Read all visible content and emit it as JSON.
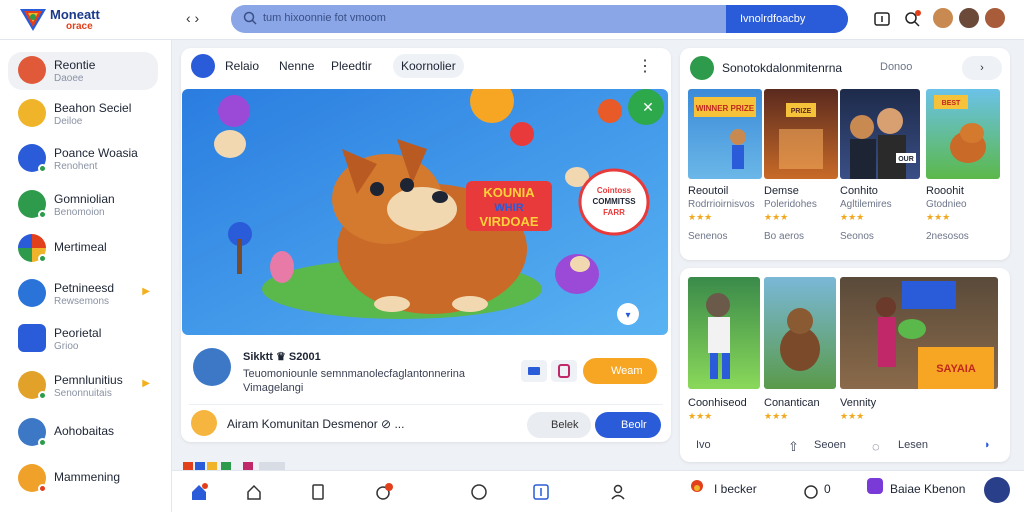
{
  "app": {
    "brand_line1": "Moneatt",
    "brand_line2": "orace"
  },
  "header": {
    "back_label": "‹ ›",
    "search_placeholder": "tum hixoonnie fot vmoom",
    "search_button": "Ivnolrdfoacby",
    "notification_count": "1"
  },
  "sidebar": {
    "items": [
      {
        "title": "Reontie",
        "subtitle": "Daoee",
        "color": "#e05a3a"
      },
      {
        "title": "Beahon Seciel",
        "subtitle": "Deiloe",
        "color": "#f0b42a"
      },
      {
        "title": "Poance Woasia",
        "subtitle": "Renohent",
        "color": "#2a5bd8"
      },
      {
        "title": "Gomniolian",
        "subtitle": "Benomoion",
        "color": "#2d9b4b"
      },
      {
        "title": "Mertimeal",
        "subtitle": "",
        "color": "#e2401c"
      },
      {
        "title": "Petnineesd",
        "subtitle": "Rewsemons",
        "color": "#2a73d8"
      },
      {
        "title": "Peorietal",
        "subtitle": "Grioo",
        "color": "#2a5bd8"
      },
      {
        "title": "Pemnlunitius",
        "subtitle": "Senonnuitais",
        "color": "#e2a22a"
      },
      {
        "title": "Aohobaitas",
        "subtitle": "",
        "color": "#3c78c6"
      },
      {
        "title": "Mammening",
        "subtitle": "",
        "color": "#f0a12a"
      }
    ]
  },
  "main": {
    "tabs": [
      "Relaio",
      "Nenne",
      "Pleedtir",
      "Koornolier"
    ],
    "hero": {
      "banner_line1": "KOUNIA",
      "banner_line2": "WHIR",
      "banner_line3": "VIRDOAE",
      "bubble_line1": "Cointoss",
      "bubble_line2": "COMMITSS",
      "bubble_line3": "FARR"
    },
    "post": {
      "title": "Sikktt ♛ S2001",
      "desc_line1": "Teuomoniounle semnmanolecfaglantonnerina",
      "desc_line2": "Vimagelangi",
      "join_label": "Weam"
    },
    "community": {
      "text": "Airam Komunitan Desmenor ⊘ ...",
      "btn_grey": "Belek",
      "btn_blue": "Beolr"
    }
  },
  "right_panel": {
    "title": "Sonotokdalonmitenrna",
    "subtitle": "Donoo",
    "button": "›",
    "cards": [
      {
        "title": "Reoutoil",
        "sub": "Rodrrioirnisvos",
        "stars": "★★★",
        "count": "Senenos"
      },
      {
        "title": "Demse",
        "sub": "Poleridohes",
        "stars": "★★★",
        "count": "Bo aeros"
      },
      {
        "title": "Conhito",
        "sub": "Agltilemires",
        "stars": "★★★",
        "count": "Seonos"
      },
      {
        "title": "Rooohit",
        "sub": "Gtodnieo",
        "stars": "★★★",
        "count": "2nesosos"
      }
    ],
    "card_badges": [
      "WINNER PRIZE",
      "PRIZE",
      "OUR",
      "BEST"
    ]
  },
  "right_panel2": {
    "videos": [
      {
        "title": "Coonhiseod",
        "stars": "★★★"
      },
      {
        "title": "Conantican",
        "stars": "★★★"
      },
      {
        "title": "Vennity",
        "stars": "★★★"
      }
    ],
    "overlay_text": "SAYAIA",
    "footer": {
      "left": "Ivo",
      "mid": "Seoen",
      "right": "Lesen"
    }
  },
  "bottom_nav": {
    "left_text": "I becker",
    "mid_count": "0",
    "right_text": "Baiae Kbenon",
    "badge_count": "1"
  },
  "colors": {
    "accent": "#2a5bd8",
    "orange": "#f6a623",
    "search_bg": "#8aa6e6"
  }
}
